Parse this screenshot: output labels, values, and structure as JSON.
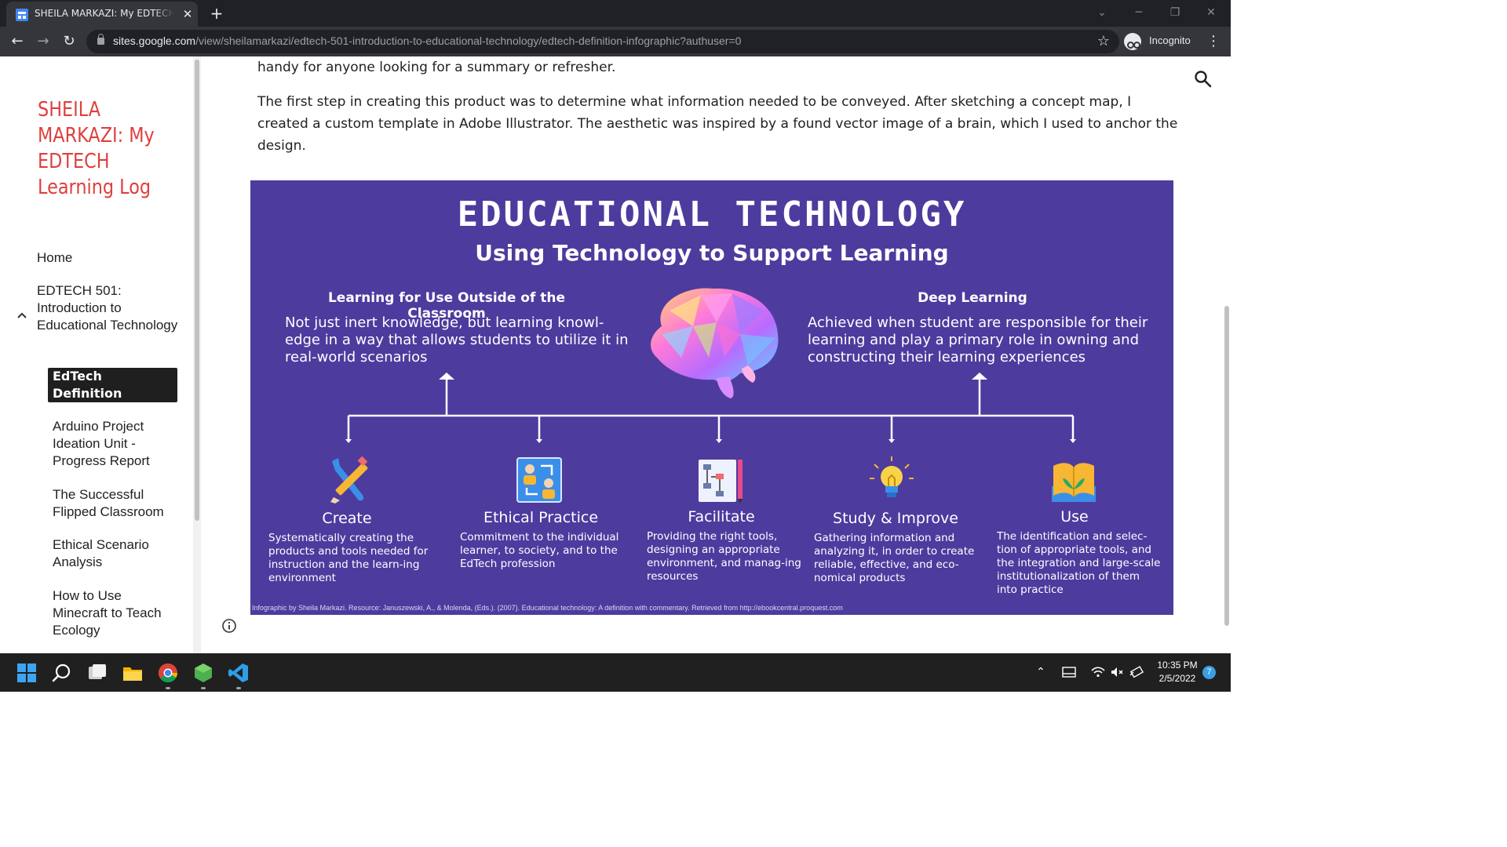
{
  "browser": {
    "tab_title": "SHEILA MARKAZI: My EDTECH Learning Log",
    "url_host": "sites.google.com",
    "url_path": "/view/sheilamarkazi/edtech-501-introduction-to-educational-technology/edtech-definition-infographic?authuser=0",
    "incognito_label": "Incognito",
    "icons": [
      "back-arrow-icon",
      "forward-arrow-icon",
      "reload-icon",
      "lock-icon",
      "star-icon",
      "incognito-icon",
      "more-vert-icon"
    ]
  },
  "sidebar": {
    "site_title": "SHEILA MARKAZI: My EDTECH Learning Log",
    "items": [
      {
        "label": "Home"
      },
      {
        "label": "EDTECH 501: Introduction to Educational Technology"
      },
      {
        "label": "EdTech Definition Infographic"
      },
      {
        "label": "Arduino Project Ideation Unit - Progress Report"
      },
      {
        "label": "The Successful Flipped Classroom"
      },
      {
        "label": "Ethical Scenario Analysis"
      },
      {
        "label": "How to Use Minecraft to Teach Ecology"
      }
    ],
    "title_color": "#e03e3e"
  },
  "content": {
    "para1": "handy for anyone looking for a summary or refresher.",
    "para2": "The first step in creating this product was to determine what information needed to be conveyed. After sketching a concept map, I created a custom template in Adobe Illustrator. The aesthetic was inspired by a found vector image of a brain, which I used to anchor the design."
  },
  "infographic": {
    "title": "EDUCATIONAL TECHNOLOGY",
    "subtitle": "Using Technology to Support Learning",
    "left_heading": "Learning for Use Outside of the Classroom",
    "left_text": "Not just inert knowledge, but learning knowl-edge in a way that allows students to utilize it in real-world scenarios",
    "right_heading": "Deep Learning",
    "right_text": "Achieved when student are responsible for their learning and play a primary role in owning and constructing their learning experiences",
    "items": [
      {
        "title": "Create",
        "desc": "Systematically creating the products and tools needed for instruction and the learn-ing environment",
        "icon": "tools-icon"
      },
      {
        "title": "Ethical Practice",
        "desc": "Commitment to the individual learner, to society, and to the EdTech profession",
        "icon": "people-exchange-icon"
      },
      {
        "title": "Facilitate",
        "desc": "Providing the right tools, designing an appropriate environment, and manag-ing resources",
        "icon": "flowchart-icon"
      },
      {
        "title": "Study & Improve",
        "desc": "Gathering information and analyzing it, in order to create reliable, effective, and eco-nomical products",
        "icon": "lightbulb-icon"
      },
      {
        "title": "Use",
        "desc": "The identification and selec-tion of appropriate tools, and the integration and large-scale institutionalization of them into practice",
        "icon": "book-plant-icon"
      }
    ],
    "citation": "Infographic by Sheila Markazi. Resource: Januszewski, A., & Molenda, (Eds.). (2007). Educational technology: A definition with commentary. Retrieved from http://ebookcentral.proquest.com",
    "background_color": "#4e3b9e"
  },
  "taskbar": {
    "time": "10:35 PM",
    "date": "2/5/2022",
    "notification_count": "7",
    "apps": [
      "windows-start-icon",
      "search-icon",
      "task-view-icon",
      "file-explorer-icon",
      "chrome-icon",
      "node-icon",
      "vscode-icon"
    ]
  }
}
